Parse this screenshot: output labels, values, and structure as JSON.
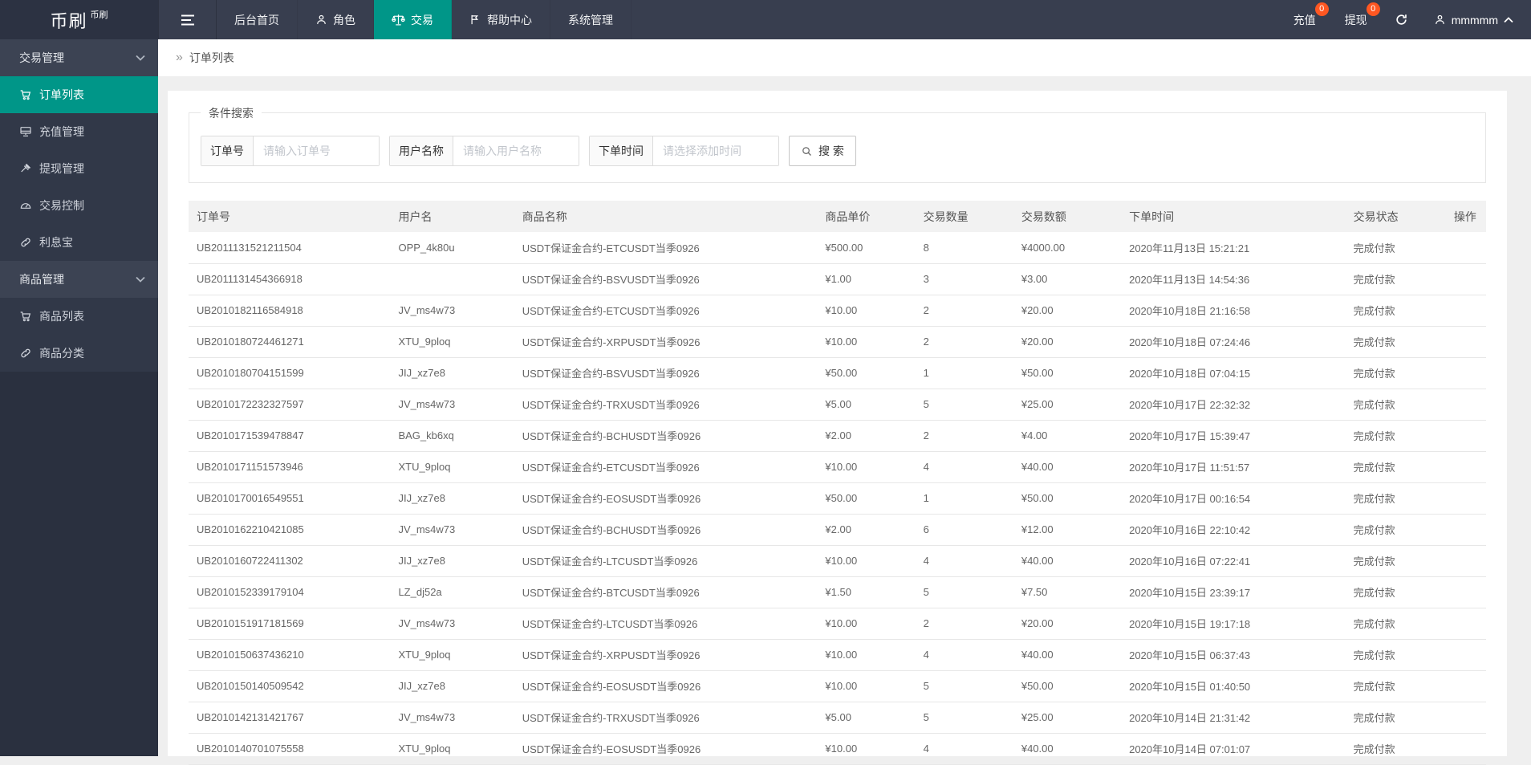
{
  "topbar": {
    "logo": "币刷",
    "logo_sup": "币刷",
    "nav": [
      {
        "label": "后台首页",
        "icon": ""
      },
      {
        "label": "角色",
        "icon": "user-icon"
      },
      {
        "label": "交易",
        "icon": "scales-icon",
        "active": true
      },
      {
        "label": "帮助中心",
        "icon": "flag-icon"
      },
      {
        "label": "系统管理",
        "icon": ""
      }
    ],
    "recharge": {
      "label": "充值",
      "badge": "0"
    },
    "withdraw": {
      "label": "提现",
      "badge": "0"
    },
    "refresh_icon": "refresh-icon",
    "username": "mmmmm"
  },
  "sidebar": {
    "groups": [
      {
        "label": "交易管理",
        "items": [
          {
            "label": "订单列表",
            "icon": "cart-icon",
            "active": true
          },
          {
            "label": "充值管理",
            "icon": "board-icon"
          },
          {
            "label": "提现管理",
            "icon": "gavel-icon"
          },
          {
            "label": "交易控制",
            "icon": "gauge-icon"
          },
          {
            "label": "利息宝",
            "icon": "link-icon"
          }
        ]
      },
      {
        "label": "商品管理",
        "items": [
          {
            "label": "商品列表",
            "icon": "cart-icon"
          },
          {
            "label": "商品分类",
            "icon": "link-icon"
          }
        ]
      }
    ]
  },
  "breadcrumb": {
    "separator": "»",
    "title": "订单列表"
  },
  "search": {
    "legend": "条件搜索",
    "fields": [
      {
        "label": "订单号",
        "placeholder": "请输入订单号"
      },
      {
        "label": "用户名称",
        "placeholder": "请输入用户名称"
      },
      {
        "label": "下单时间",
        "placeholder": "请选择添加时间"
      }
    ],
    "button_label": "搜 索"
  },
  "table": {
    "headers": [
      "订单号",
      "用户名",
      "商品名称",
      "商品单价",
      "交易数量",
      "交易数额",
      "下单时间",
      "交易状态",
      "操作"
    ],
    "rows": [
      [
        "UB2011131521211504",
        "OPP_4k80u",
        "USDT保证金合约-ETCUSDT当季0926",
        "¥500.00",
        "8",
        "¥4000.00",
        "2020年11月13日 15:21:21",
        "完成付款",
        ""
      ],
      [
        "UB2011131454366918",
        "",
        "USDT保证金合约-BSVUSDT当季0926",
        "¥1.00",
        "3",
        "¥3.00",
        "2020年11月13日 14:54:36",
        "完成付款",
        ""
      ],
      [
        "UB2010182116584918",
        "JV_ms4w73",
        "USDT保证金合约-ETCUSDT当季0926",
        "¥10.00",
        "2",
        "¥20.00",
        "2020年10月18日 21:16:58",
        "完成付款",
        ""
      ],
      [
        "UB2010180724461271",
        "XTU_9ploq",
        "USDT保证金合约-XRPUSDT当季0926",
        "¥10.00",
        "2",
        "¥20.00",
        "2020年10月18日 07:24:46",
        "完成付款",
        ""
      ],
      [
        "UB2010180704151599",
        "JIJ_xz7e8",
        "USDT保证金合约-BSVUSDT当季0926",
        "¥50.00",
        "1",
        "¥50.00",
        "2020年10月18日 07:04:15",
        "完成付款",
        ""
      ],
      [
        "UB2010172232327597",
        "JV_ms4w73",
        "USDT保证金合约-TRXUSDT当季0926",
        "¥5.00",
        "5",
        "¥25.00",
        "2020年10月17日 22:32:32",
        "完成付款",
        ""
      ],
      [
        "UB2010171539478847",
        "BAG_kb6xq",
        "USDT保证金合约-BCHUSDT当季0926",
        "¥2.00",
        "2",
        "¥4.00",
        "2020年10月17日 15:39:47",
        "完成付款",
        ""
      ],
      [
        "UB2010171151573946",
        "XTU_9ploq",
        "USDT保证金合约-ETCUSDT当季0926",
        "¥10.00",
        "4",
        "¥40.00",
        "2020年10月17日 11:51:57",
        "完成付款",
        ""
      ],
      [
        "UB2010170016549551",
        "JIJ_xz7e8",
        "USDT保证金合约-EOSUSDT当季0926",
        "¥50.00",
        "1",
        "¥50.00",
        "2020年10月17日 00:16:54",
        "完成付款",
        ""
      ],
      [
        "UB2010162210421085",
        "JV_ms4w73",
        "USDT保证金合约-BCHUSDT当季0926",
        "¥2.00",
        "6",
        "¥12.00",
        "2020年10月16日 22:10:42",
        "完成付款",
        ""
      ],
      [
        "UB2010160722411302",
        "JIJ_xz7e8",
        "USDT保证金合约-LTCUSDT当季0926",
        "¥10.00",
        "4",
        "¥40.00",
        "2020年10月16日 07:22:41",
        "完成付款",
        ""
      ],
      [
        "UB2010152339179104",
        "LZ_dj52a",
        "USDT保证金合约-BTCUSDT当季0926",
        "¥1.50",
        "5",
        "¥7.50",
        "2020年10月15日 23:39:17",
        "完成付款",
        ""
      ],
      [
        "UB2010151917181569",
        "JV_ms4w73",
        "USDT保证金合约-LTCUSDT当季0926",
        "¥10.00",
        "2",
        "¥20.00",
        "2020年10月15日 19:17:18",
        "完成付款",
        ""
      ],
      [
        "UB2010150637436210",
        "XTU_9ploq",
        "USDT保证金合约-XRPUSDT当季0926",
        "¥10.00",
        "4",
        "¥40.00",
        "2020年10月15日 06:37:43",
        "完成付款",
        ""
      ],
      [
        "UB2010150140509542",
        "JIJ_xz7e8",
        "USDT保证金合约-EOSUSDT当季0926",
        "¥10.00",
        "5",
        "¥50.00",
        "2020年10月15日 01:40:50",
        "完成付款",
        ""
      ],
      [
        "UB2010142131421767",
        "JV_ms4w73",
        "USDT保证金合约-TRXUSDT当季0926",
        "¥5.00",
        "5",
        "¥25.00",
        "2020年10月14日 21:31:42",
        "完成付款",
        ""
      ],
      [
        "UB2010140701075558",
        "XTU_9ploq",
        "USDT保证金合约-EOSUSDT当季0926",
        "¥10.00",
        "4",
        "¥40.00",
        "2020年10月14日 07:01:07",
        "完成付款",
        ""
      ]
    ]
  },
  "colors": {
    "accent_teal": "#009688",
    "badge_red": "#ff5722",
    "topbar_bg": "#383e4f",
    "sidebar_bg": "#313848"
  }
}
